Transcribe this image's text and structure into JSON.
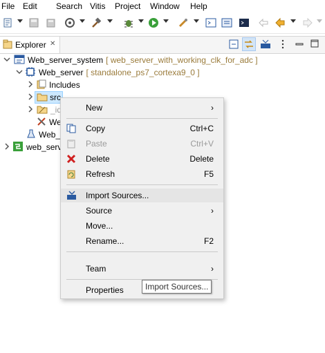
{
  "menubar": {
    "items": [
      "File",
      "Edit",
      "Search",
      "Vitis",
      "Project",
      "Window",
      "Help"
    ]
  },
  "toolbar": {
    "icons": [
      "new-icon",
      "save-icon",
      "save-all-icon",
      "build-settings-icon",
      "hammer-icon",
      "debug-icon",
      "run-icon",
      "launch-icon",
      "console-icon",
      "terminal-icon",
      "back-icon",
      "forward-icon"
    ]
  },
  "explorer": {
    "tab_label": "Explorer",
    "close_glyph": "✕"
  },
  "tree": {
    "system": {
      "name": "Web_server_system",
      "detail": "[ web_server_with_working_clk_for_adc ]"
    },
    "app": {
      "name": "Web_server",
      "detail": "[ standalone_ps7_cortexa9_0 ]"
    },
    "includes": "Includes",
    "src": "src",
    "ide": "_id",
    "we": "We",
    "web_sub": "Web_",
    "web_serv": "web_serv"
  },
  "context_menu": {
    "new": "New",
    "copy": "Copy",
    "copy_shortcut": "Ctrl+C",
    "paste": "Paste",
    "paste_shortcut": "Ctrl+V",
    "delete": "Delete",
    "delete_shortcut": "Delete",
    "refresh": "Refresh",
    "refresh_shortcut": "F5",
    "import_sources": "Import Sources...",
    "source": "Source",
    "move": "Move...",
    "rename": "Rename...",
    "rename_shortcut": "F2",
    "team": "Team",
    "properties": "Properties"
  },
  "tooltip": "Import Sources..."
}
